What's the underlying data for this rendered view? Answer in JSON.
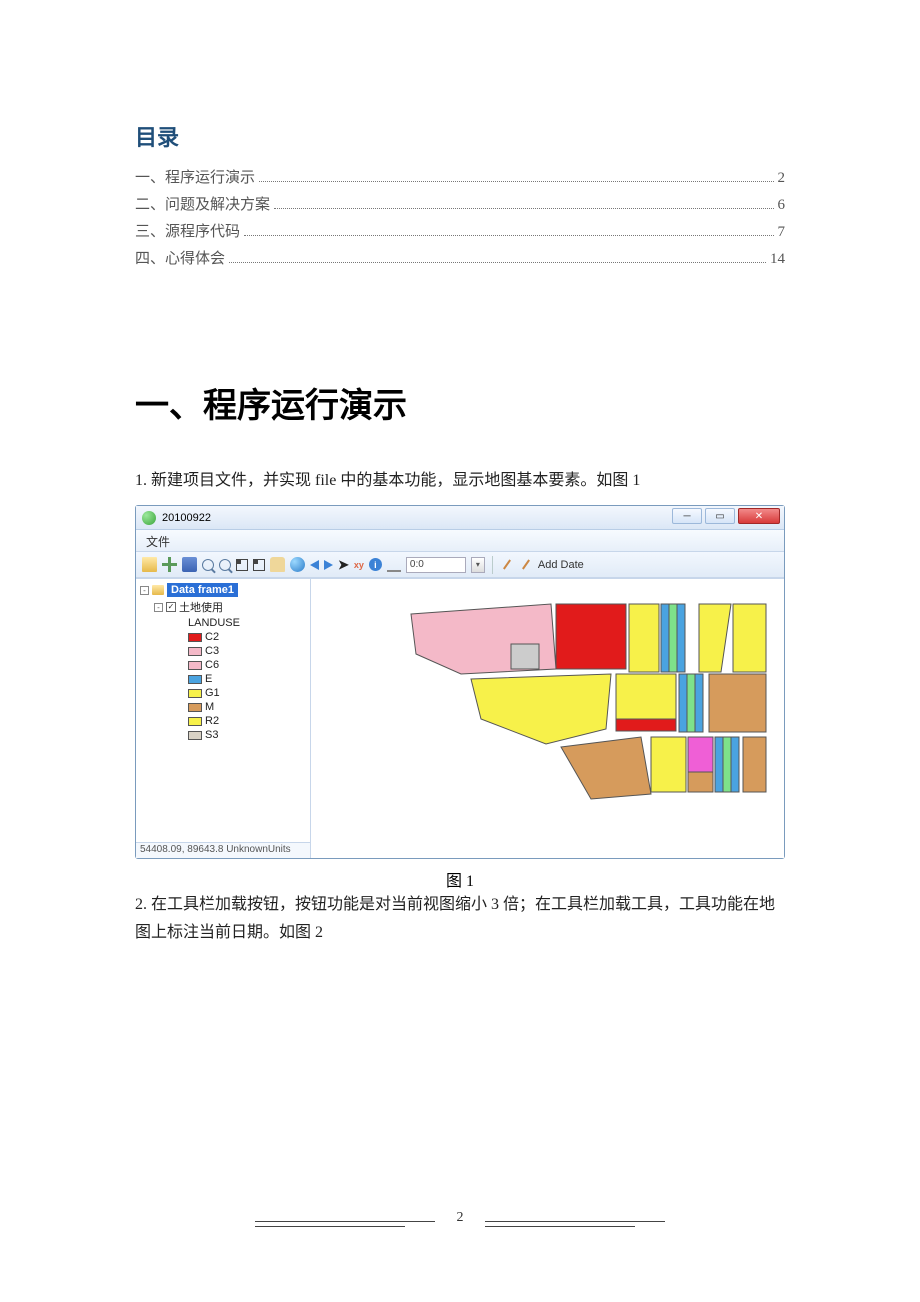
{
  "toc_title": "目录",
  "toc": [
    {
      "label": "一、程序运行演示",
      "page": "2"
    },
    {
      "label": "二、问题及解决方案",
      "page": "6"
    },
    {
      "label": "三、源程序代码",
      "page": "7"
    },
    {
      "label": "四、心得体会",
      "page": "14"
    }
  ],
  "section_heading": "一、程序运行演示",
  "para1": "1. 新建项目文件，并实现 file 中的基本功能，显示地图基本要素。如图 1",
  "caption1": "图 1",
  "para2": "2. 在工具栏加载按钮，按钮功能是对当前视图缩小 3 倍；在工具栏加载工具，工具功能在地图上标注当前日期。如图 2",
  "page_number": "2",
  "app": {
    "title": "20100922",
    "menu_file": "文件",
    "toolbar": {
      "scale": "0:0",
      "add_date": "Add Date"
    },
    "tree": {
      "data_frame": "Data frame1",
      "layer": "土地使用",
      "field": "LANDUSE",
      "legend": [
        {
          "label": "C2",
          "color": "#e11b1b"
        },
        {
          "label": "C3",
          "color": "#f4b9c8"
        },
        {
          "label": "C6",
          "color": "#f4b9c8"
        },
        {
          "label": "E",
          "color": "#4aa3e0"
        },
        {
          "label": "G1",
          "color": "#f7f14a"
        },
        {
          "label": "M",
          "color": "#d69b5c"
        },
        {
          "label": "R2",
          "color": "#f7f14a"
        },
        {
          "label": "S3",
          "color": "#d9d2c5"
        }
      ]
    },
    "status": "54408.09, 89643.8  UnknownUnits"
  }
}
